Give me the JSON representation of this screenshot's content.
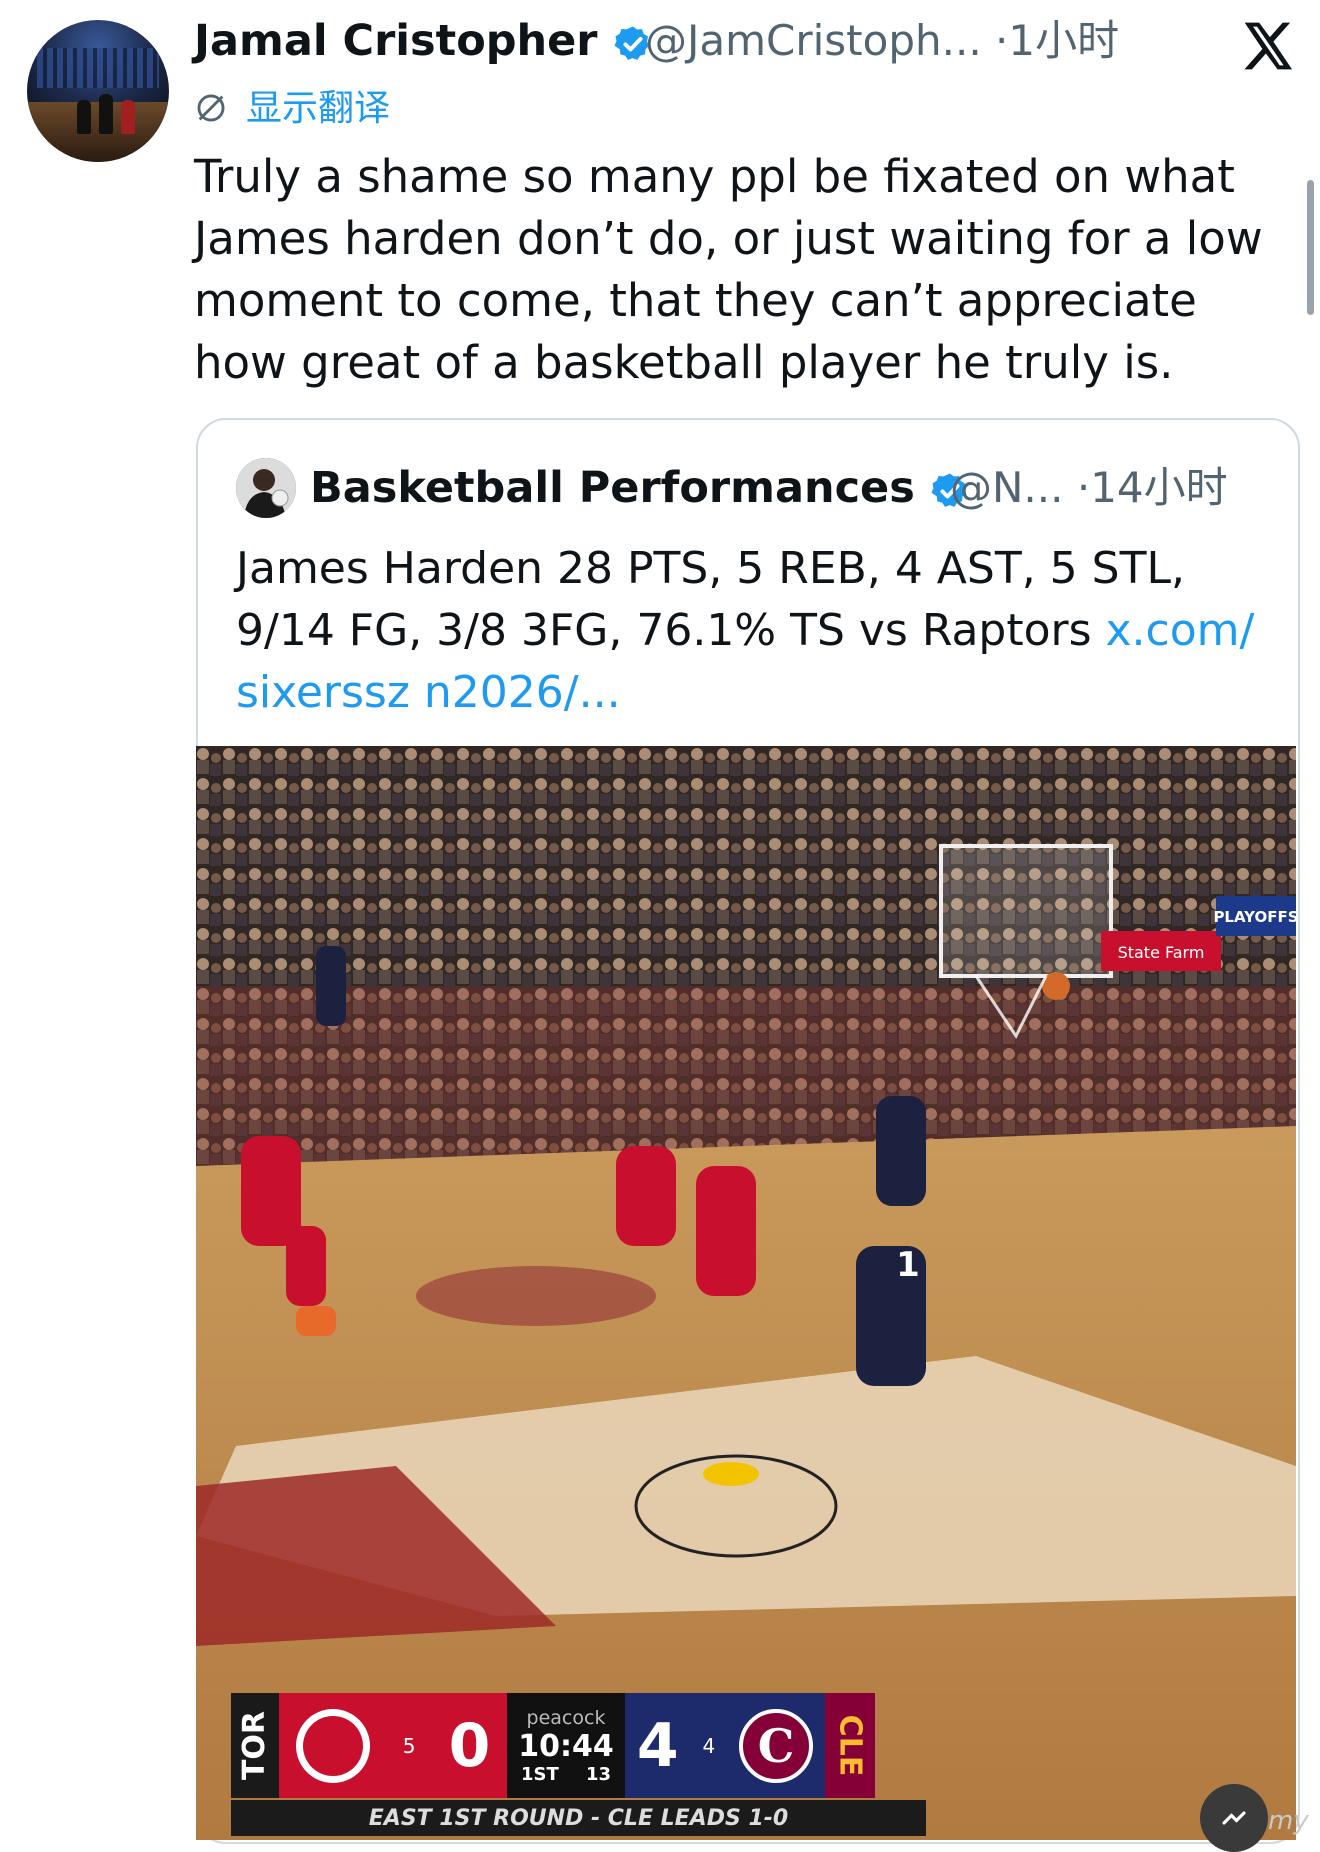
{
  "tweet": {
    "author_name": "Jamal Cristopher",
    "handle": "@JamCristoph...",
    "dot": "·",
    "time": "1小时",
    "translate_label": "显示翻译",
    "text": "Truly a shame so many ppl be fixated on what James harden don’t do, or just waiting for a low moment to come, that they can’t appreciate how great of a basketball player he truly is."
  },
  "quote": {
    "author_name": "Basketball Performances",
    "handle": "@N...",
    "dot": "·",
    "time": "14小时",
    "text": "James Harden 28 PTS, 5 REB, 4 AST, 5 STL, 9/14 FG, 3/8 3FG, 76.1% TS vs Raptors ",
    "link": "x.com/ sixerssz n2026/..."
  },
  "video": {
    "scorebug": {
      "away_abbr": "TOR",
      "away_timeouts": "5",
      "away_score": "0",
      "network": "peacock",
      "clock": "10:44",
      "period": "1ST",
      "shot_clock": "13",
      "home_score": "4",
      "home_timeouts": "4",
      "home_abbr": "CLE"
    },
    "ticker": "EAST 1ST ROUND - CLE LEADS 1-0",
    "arena_signs": [
      "PLAYOFFS",
      "State Farm"
    ],
    "jersey_number": "1"
  },
  "watermark": "my",
  "colors": {
    "accent": "#1d9bf0",
    "text": "#0f1419",
    "secondary": "#536471",
    "raptors_red": "#c8102e",
    "cavs_wine": "#860038",
    "cavs_navy": "#1d2a6b"
  },
  "icons": [
    "x-logo-icon",
    "verified-badge-icon",
    "translate-icon",
    "play-icon"
  ]
}
